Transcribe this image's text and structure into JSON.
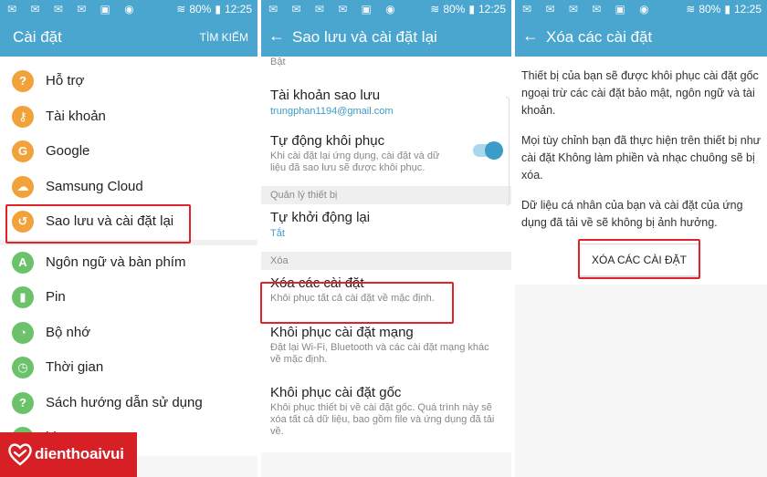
{
  "status": {
    "percent": "80%",
    "time": "12:25"
  },
  "panel1": {
    "title": "Cài đặt",
    "action": "TÌM KIẾM",
    "items": [
      {
        "label": "Hỗ trợ",
        "icon": "help-icon",
        "color": "#f2a23a",
        "glyph": "?"
      },
      {
        "label": "Tài khoản",
        "icon": "key-icon",
        "color": "#f2a23a",
        "glyph": "⚷"
      },
      {
        "label": "Google",
        "icon": "google-icon",
        "color": "#f2a23a",
        "glyph": "G"
      },
      {
        "label": "Samsung Cloud",
        "icon": "cloud-icon",
        "color": "#f2a23a",
        "glyph": "☁"
      },
      {
        "label": "Sao lưu và cài đặt lại",
        "icon": "backup-icon",
        "color": "#f2a23a",
        "glyph": "↺"
      },
      {
        "label": "Ngôn ngữ và bàn phím",
        "icon": "language-icon",
        "color": "#6cc26a",
        "glyph": "A"
      },
      {
        "label": "Pin",
        "icon": "battery-icon",
        "color": "#6cc26a",
        "glyph": "▮"
      },
      {
        "label": "Bộ nhớ",
        "icon": "storage-icon",
        "color": "#6cc26a",
        "glyph": "◔"
      },
      {
        "label": "Thời gian",
        "icon": "clock-icon",
        "color": "#6cc26a",
        "glyph": "◷"
      },
      {
        "label": "Sách hướng dẫn sử dụng",
        "icon": "manual-icon",
        "color": "#6cc26a",
        "glyph": "?"
      },
      {
        "label": "bị",
        "icon": "device-icon",
        "color": "#6cc26a",
        "glyph": "i"
      }
    ]
  },
  "panel2": {
    "title": "Sao lưu và cài đặt lại",
    "top_sub": "Bật",
    "backup_account": {
      "title": "Tài khoản sao lưu",
      "value": "trungphan1194@gmail.com"
    },
    "auto_restore": {
      "title": "Tự động khôi phục",
      "sub": "Khi cài đặt lại ứng dụng, cài đặt và dữ liệu đã sao lưu sẽ được khôi phục."
    },
    "section_device": "Quản lý thiết bị",
    "auto_restart": {
      "title": "Tự khởi động lại",
      "value": "Tắt"
    },
    "section_reset": "Xóa",
    "reset_settings": {
      "title": "Xóa các cài đặt",
      "sub": "Khôi phục tất cả cài đặt về mặc định."
    },
    "reset_network": {
      "title": "Khôi phục cài đặt mạng",
      "sub": "Đặt lại Wi-Fi, Bluetooth và các cài đặt mạng khác về mặc định."
    },
    "factory_reset": {
      "title": "Khôi phục cài đặt gốc",
      "sub": "Khôi phục thiết bị về cài đặt gốc. Quá trình này sẽ xóa tất cả dữ liệu, bao gồm file và ứng dụng đã tải về."
    }
  },
  "panel3": {
    "title": "Xóa các cài đặt",
    "para1": "Thiết bị của bạn sẽ được khôi phục cài đặt gốc ngoại trừ các cài đặt bảo mật, ngôn ngữ và tài khoản.",
    "para2": "Mọi tùy chỉnh bạn đã thực hiện trên thiết bị như cài đặt Không làm phiền và nhạc chuông sẽ bị xóa.",
    "para3": "Dữ liệu cá nhân của bạn và cài đặt của ứng dụng đã tải về sẽ không bị ảnh hưởng.",
    "button": "XÓA CÁC CÀI ĐẶT"
  },
  "logo": {
    "text": "dienthoaivui"
  },
  "colors": {
    "appbar": "#4aa6cf",
    "accent": "#3b9cc9",
    "highlight": "#e0232a",
    "brand": "#d71f26"
  }
}
